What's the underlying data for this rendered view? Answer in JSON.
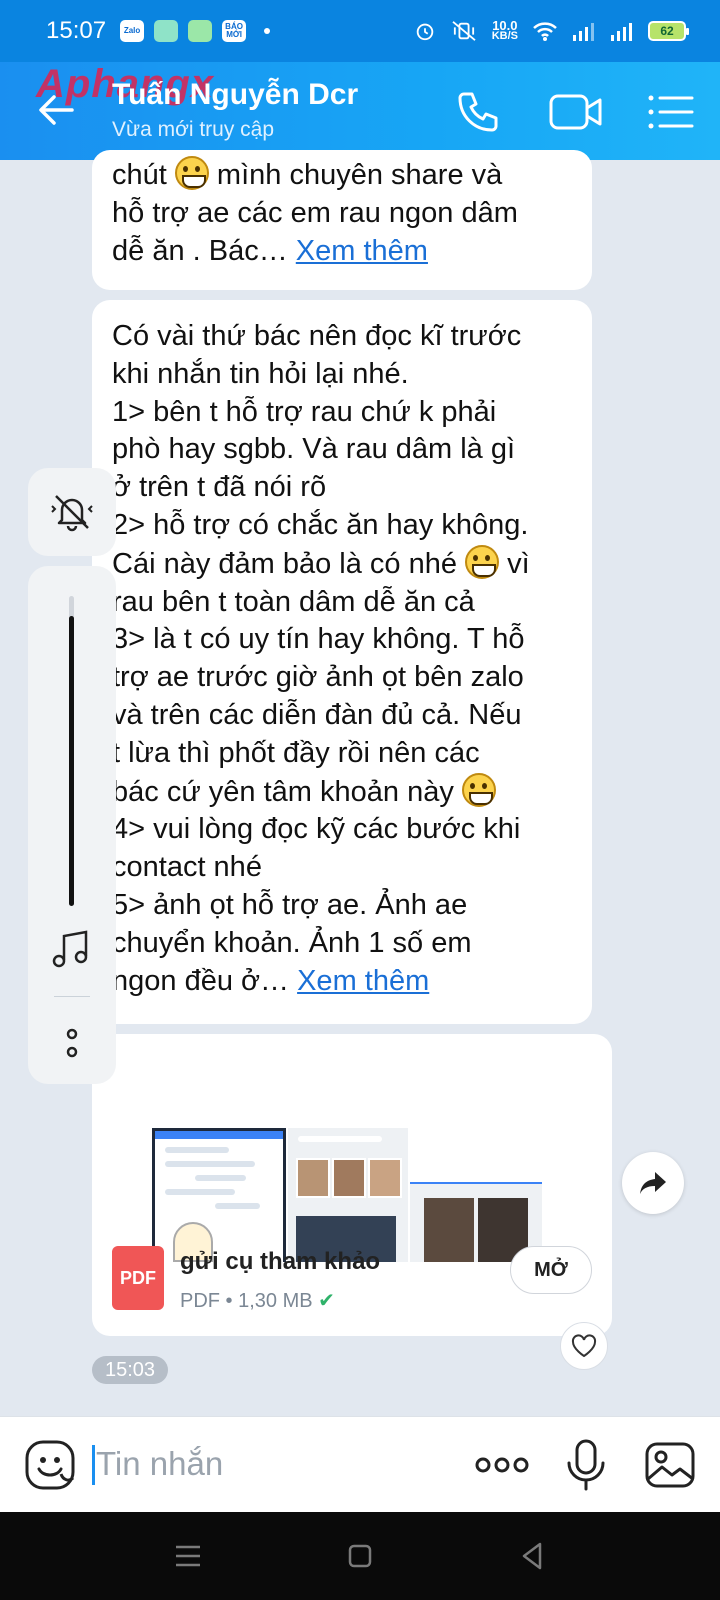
{
  "status_bar": {
    "time": "15:07",
    "app_icons": [
      "Zalo",
      "",
      "",
      "BÁO MỚI"
    ],
    "net_speed_value": "10.0",
    "net_speed_unit": "KB/S",
    "battery": "62"
  },
  "header": {
    "watermark": "Aphangx",
    "contact_name": "Tuấn Nguyễn Dcr",
    "contact_status": "Vừa mới truy cập"
  },
  "messages": {
    "first": {
      "lines": [
        {
          "before": "chút ",
          "emoji": true,
          "after": " mình chuyên share và"
        },
        {
          "text": "hỗ trợ ae các em rau ngon dâm"
        },
        {
          "text": "dễ ăn . Bác… ",
          "link": "Xem thêm"
        }
      ]
    },
    "second": {
      "lines": [
        {
          "text": "Có vài thứ bác nên đọc kĩ trước"
        },
        {
          "text": "khi nhắn tin hỏi lại nhé."
        },
        {
          "text": "1> bên t hỗ trợ rau chứ k phải"
        },
        {
          "text": "phò hay sgbb. Và rau dâm là gì"
        },
        {
          "text": "ở trên t đã nói rõ"
        },
        {
          "text": "2> hỗ trợ có chắc ăn hay không."
        },
        {
          "before": "Cái này đảm bảo là có nhé ",
          "emoji": true,
          "after": " vì"
        },
        {
          "text": "rau bên t toàn dâm dễ ăn cả"
        },
        {
          "text": "3> là t có uy tín hay không. T hỗ"
        },
        {
          "text": "trợ ae trước giờ ảnh ọt bên zalo"
        },
        {
          "text": "và trên các diễn đàn đủ cả. Nếu"
        },
        {
          "text": "t lừa thì phốt đầy rồi nên các"
        },
        {
          "before": "bác cứ yên tâm khoản này ",
          "emoji": true,
          "after": ""
        },
        {
          "text": "4> vui lòng đọc kỹ các bước khi"
        },
        {
          "text": "contact nhé"
        },
        {
          "text": "5> ảnh ọt hỗ trợ ae. Ảnh ae"
        },
        {
          "text": "chuyển khoản. Ảnh 1 số em"
        },
        {
          "text": "ngon đều ở… ",
          "link": "Xem thêm"
        }
      ]
    },
    "file": {
      "name": "gửi cụ tham khảo",
      "type_badge": "PDF",
      "meta": "PDF • 1,30 MB",
      "open_label": "MỞ"
    },
    "time": "15:03"
  },
  "input": {
    "placeholder": "Tin nhắn"
  },
  "colors": {
    "header": "#1a8ff0",
    "link": "#1a6fd6",
    "pdf": "#f05656",
    "check": "#2fb26a"
  },
  "icons": [
    "back-arrow-icon",
    "phone-icon",
    "video-call-icon",
    "menu-icon",
    "mute-icon",
    "music-note-icon",
    "more-vertical-icon",
    "forward-icon",
    "heart-icon",
    "sticker-icon",
    "more-horizontal-icon",
    "microphone-icon",
    "image-icon",
    "nav-menu-icon",
    "nav-home-icon",
    "nav-back-icon"
  ]
}
